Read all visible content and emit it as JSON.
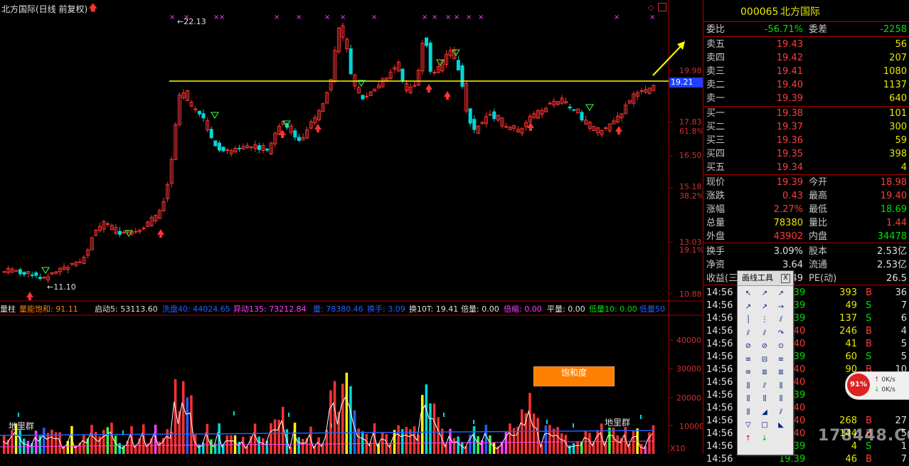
{
  "chart_title": "北方国际(日线 前复权)",
  "price_axis": [
    "19.98",
    "17.83",
    "61.8%",
    "16.50",
    "15.18",
    "38.2%",
    "13.03",
    "19.1%",
    "10.88"
  ],
  "volume_axis": [
    "40000",
    "30000",
    "20000",
    "10000",
    "X10"
  ],
  "annotations": {
    "high": "22.13",
    "low": "11.10",
    "current": "19.21"
  },
  "indicator_line": {
    "name": "量柱",
    "items": [
      {
        "text": "量能饱和: 91.11",
        "color": "#ff8000"
      },
      {
        "text": "启动5: 53113.60",
        "color": "#e0e0e0"
      },
      {
        "text": "洗盘40: 44024.65",
        "color": "#2060ff"
      },
      {
        "text": "异动135: 73212.84",
        "color": "#ff40ff"
      },
      {
        "text": "量: 78380.46",
        "color": "#2060ff"
      },
      {
        "text": "换手: 3.09",
        "color": "#2060ff"
      },
      {
        "text": "换10T: 19.41",
        "color": "#e0e0e0"
      },
      {
        "text": "倍量: 0.00",
        "color": "#e0e0e0"
      },
      {
        "text": "倍缩: 0.00",
        "color": "#ff40ff"
      },
      {
        "text": "平量: 0.00",
        "color": "#e0e0e0"
      },
      {
        "text": "低量10: 0.00",
        "color": "#00e000"
      },
      {
        "text": "低量50",
        "color": "#2060ff"
      }
    ]
  },
  "labels": {
    "dlq_left": "地里群",
    "dlq_right": "地里群",
    "saturation_box": "饱和度"
  },
  "quote": {
    "code": "000065",
    "name": "北方国际",
    "weibi_label": "委比",
    "weibi": "-56.71%",
    "weicha_label": "委差",
    "weicha": "-2258",
    "asks": [
      {
        "label": "卖五",
        "price": "19.43",
        "vol": "56"
      },
      {
        "label": "卖四",
        "price": "19.42",
        "vol": "207"
      },
      {
        "label": "卖三",
        "price": "19.41",
        "vol": "1080"
      },
      {
        "label": "卖二",
        "price": "19.40",
        "vol": "1137"
      },
      {
        "label": "卖一",
        "price": "19.39",
        "vol": "640"
      }
    ],
    "bids": [
      {
        "label": "买一",
        "price": "19.38",
        "vol": "101"
      },
      {
        "label": "买二",
        "price": "19.37",
        "vol": "300"
      },
      {
        "label": "买三",
        "price": "19.36",
        "vol": "59"
      },
      {
        "label": "买四",
        "price": "19.35",
        "vol": "398"
      },
      {
        "label": "买五",
        "price": "19.34",
        "vol": "4"
      }
    ],
    "stats": [
      {
        "l1": "现价",
        "v1": "19.39",
        "c1": "red",
        "l2": "今开",
        "v2": "18.98",
        "c2": "red"
      },
      {
        "l1": "涨跌",
        "v1": "0.43",
        "c1": "red",
        "l2": "最高",
        "v2": "19.40",
        "c2": "red"
      },
      {
        "l1": "涨幅",
        "v1": "2.27%",
        "c1": "red",
        "l2": "最低",
        "v2": "18.69",
        "c2": "green"
      },
      {
        "l1": "总量",
        "v1": "78380",
        "c1": "yel",
        "l2": "量比",
        "v2": "1.44",
        "c2": "red"
      },
      {
        "l1": "外盘",
        "v1": "43902",
        "c1": "red",
        "l2": "内盘",
        "v2": "34478",
        "c2": "green"
      }
    ],
    "stats2": [
      {
        "l1": "换手",
        "v1": "3.09%",
        "l2": "股本",
        "v2": "2.53亿"
      },
      {
        "l1": "净资",
        "v1": "3.64",
        "l2": "流通",
        "v2": "2.53亿"
      },
      {
        "l1": "收益(三",
        "v1": "49",
        "l2": "PE(动)",
        "v2": "26.5"
      }
    ]
  },
  "ticks": [
    {
      "time": "14:56",
      "price": "19.39",
      "vol": "393",
      "bs": "B",
      "n": "36"
    },
    {
      "time": "14:56",
      "price": "19.39",
      "vol": "49",
      "bs": "S",
      "n": "7"
    },
    {
      "time": "14:56",
      "price": "19.39",
      "vol": "137",
      "bs": "S",
      "n": "6"
    },
    {
      "time": "14:56",
      "price": "19.40",
      "vol": "246",
      "bs": "B",
      "n": "4"
    },
    {
      "time": "14:56",
      "price": "19.40",
      "vol": "41",
      "bs": "B",
      "n": "5"
    },
    {
      "time": "14:56",
      "price": "19.39",
      "vol": "60",
      "bs": "S",
      "n": "5"
    },
    {
      "time": "14:56",
      "price": "19.40",
      "vol": "90",
      "bs": "B",
      "n": "10"
    },
    {
      "time": "14:56",
      "price": "19.40",
      "vol": "",
      "bs": "",
      "n": ""
    },
    {
      "time": "14:56",
      "price": "19.39",
      "vol": "",
      "bs": "",
      "n": ""
    },
    {
      "time": "14:56",
      "price": "19.40",
      "vol": "",
      "bs": "",
      "n": ""
    },
    {
      "time": "14:56",
      "price": "19.40",
      "vol": "268",
      "bs": "B",
      "n": "27"
    },
    {
      "time": "14:56",
      "price": "19.40",
      "vol": "144",
      "bs": "B",
      "n": "5"
    },
    {
      "time": "14:56",
      "price": "19.39",
      "vol": "4",
      "bs": "S",
      "n": "1"
    },
    {
      "time": "14:56",
      "price": "19.39",
      "vol": "46",
      "bs": "B",
      "n": "7"
    }
  ],
  "toolbox": {
    "title": "画线工具",
    "close": "X"
  },
  "speed": {
    "percent": "91%",
    "up": "0K/s",
    "down": "0K/s"
  },
  "watermark": "178448.COM"
}
